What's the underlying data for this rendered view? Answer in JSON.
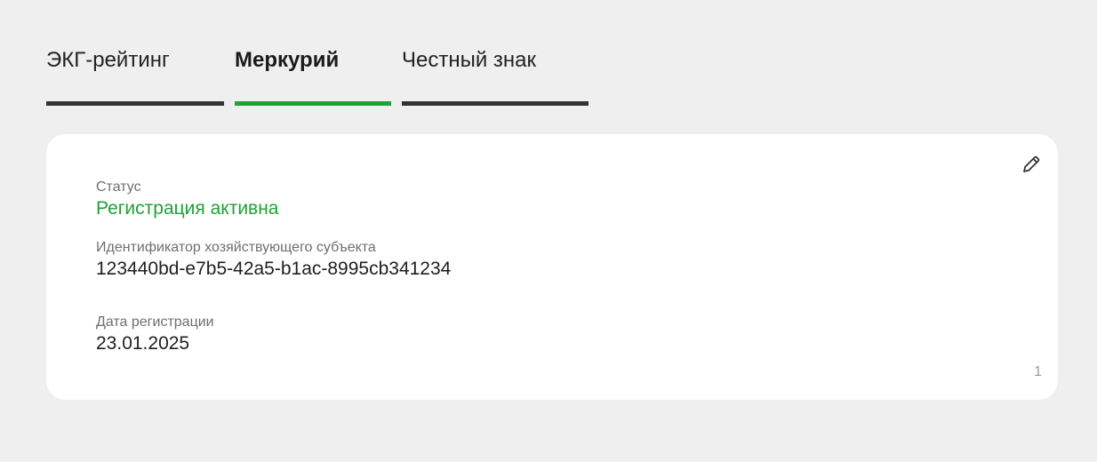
{
  "tabs": [
    {
      "label": "ЭКГ-рейтинг",
      "active": false
    },
    {
      "label": "Меркурий",
      "active": true
    },
    {
      "label": "Честный знак",
      "active": false
    }
  ],
  "card": {
    "status": {
      "label": "Статус",
      "value": "Регистрация активна"
    },
    "entity_id": {
      "label": "Идентификатор хозяйствующего субъекта",
      "value": "123440bd-e7b5-42a5-b1ac-8995cb341234"
    },
    "registration_date": {
      "label": "Дата регистрации",
      "value": "23.01.2025"
    },
    "edit_icon": "pencil-icon",
    "counter": "1"
  },
  "colors": {
    "accent": "#21a038",
    "background": "#efefef",
    "card": "#ffffff",
    "inactive_underline": "#333333"
  }
}
